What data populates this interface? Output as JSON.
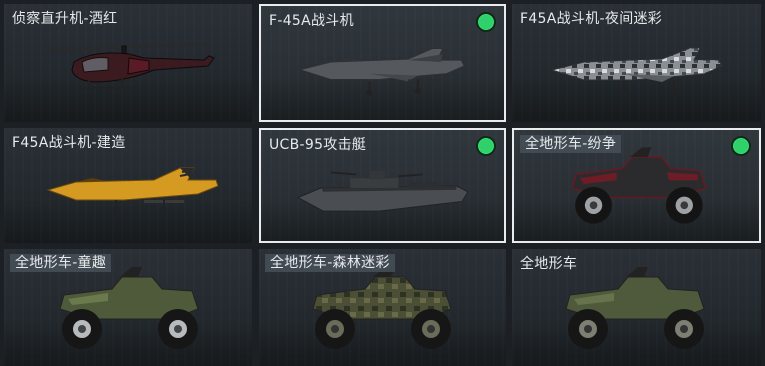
{
  "cards": [
    {
      "name": "侦察直升机-酒红",
      "equipped": false,
      "selected": false
    },
    {
      "name": "F-45A战斗机",
      "equipped": true,
      "selected": true
    },
    {
      "name": "F45A战斗机-夜间迷彩",
      "equipped": false,
      "selected": false
    },
    {
      "name": "F45A战斗机-建造",
      "equipped": false,
      "selected": false
    },
    {
      "name": "UCB-95攻击艇",
      "equipped": true,
      "selected": true
    },
    {
      "name": "全地形车-纷争",
      "equipped": true,
      "selected": true
    },
    {
      "name": "全地形车-童趣",
      "equipped": false,
      "selected": false
    },
    {
      "name": "全地形车-森林迷彩",
      "equipped": false,
      "selected": false
    },
    {
      "name": "全地形车",
      "equipped": false,
      "selected": false
    }
  ],
  "icons": {
    "equipped": "equipped-check-icon"
  },
  "colors": {
    "equipped": "#2fd26a",
    "selected_border": "#e9ecee"
  }
}
